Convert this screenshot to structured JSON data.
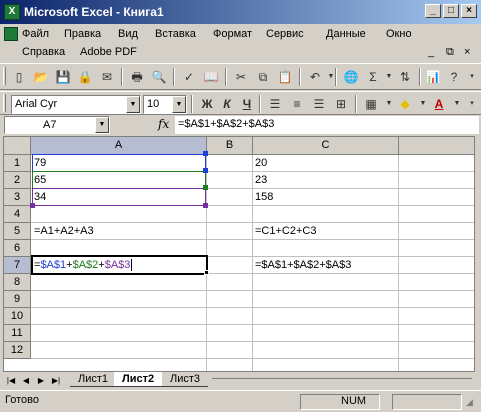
{
  "window": {
    "title": "Microsoft Excel - Книга1",
    "app_icon": "X",
    "caption_buttons": [
      "_",
      "□",
      "×"
    ]
  },
  "menu": {
    "row1": [
      "Файл",
      "Правка",
      "Вид",
      "Вставка",
      "Формат",
      "Сервис",
      "Данные",
      "Окно"
    ],
    "row2": [
      "Справка",
      "Adobe PDF"
    ],
    "mdi": [
      "_",
      "⧉",
      "×"
    ]
  },
  "format_toolbar": {
    "font": "Arial Cyr",
    "size": "10",
    "bold": "Ж",
    "italic": "К",
    "underline": "Ч"
  },
  "formula_bar": {
    "name_box": "A7",
    "fx": "fx",
    "formula": "=$A$1+$A$2+$A$3"
  },
  "columns": [
    "A",
    "B",
    "C"
  ],
  "rows": [
    "1",
    "2",
    "3",
    "4",
    "5",
    "6",
    "7",
    "8",
    "9",
    "10",
    "11",
    "12"
  ],
  "cells": {
    "A1": "79",
    "A2": "65",
    "A3": "34",
    "A5": "=A1+A2+A3",
    "A7_parts": [
      "=",
      "$A$1",
      "+",
      "$A$2",
      "+",
      "$A$3"
    ],
    "C1": "20",
    "C2": "23",
    "C3": "158",
    "C5": "=C1+C2+C3",
    "C7": "=$A$1+$A$2+$A$3"
  },
  "sheets": [
    "Лист1",
    "Лист2",
    "Лист3"
  ],
  "active_sheet": "Лист2",
  "status": {
    "mode": "Готово",
    "num": "NUM"
  },
  "colors": {
    "ref1": "#1f3fd6",
    "ref2": "#1e7b1e",
    "ref3": "#7a2fa0",
    "selection_header": "#b6bdd2"
  }
}
